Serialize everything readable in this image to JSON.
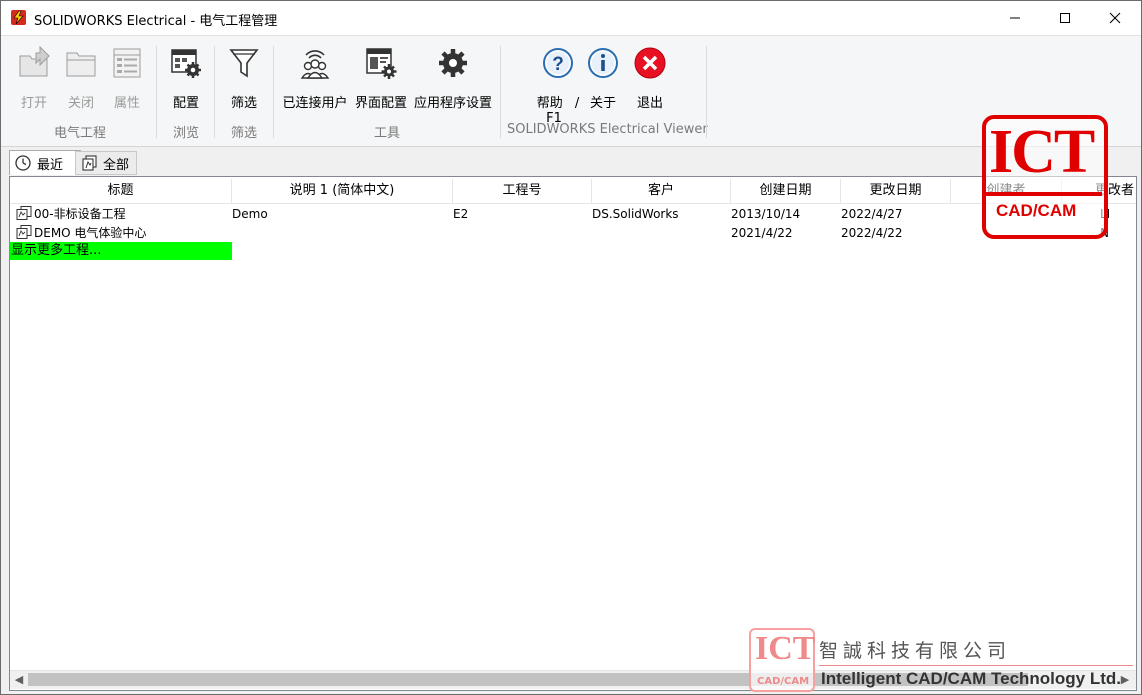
{
  "window": {
    "title": "SOLIDWORKS Electrical - 电气工程管理"
  },
  "ribbon": {
    "buttons": {
      "open": "打开",
      "close": "关闭",
      "properties": "属性",
      "configure": "配置",
      "filter": "筛选",
      "connected_users": "已连接用户",
      "interface_config": "界面配置",
      "app_settings": "应用程序设置",
      "help": "帮助",
      "help_slash": "/",
      "help_key": "F1",
      "about": "关于",
      "exit": "退出"
    },
    "groups": {
      "project": "电气工程",
      "browse": "浏览",
      "filter": "筛选",
      "tools": "工具",
      "viewer": "SOLIDWORKS Electrical Viewer"
    }
  },
  "tabs": {
    "recent": "最近",
    "all": "全部"
  },
  "table": {
    "headers": {
      "title": "标题",
      "desc": "说明 1 (简体中文)",
      "project_no": "工程号",
      "customer": "客户",
      "created": "创建日期",
      "modified": "更改日期",
      "creator": "创建者",
      "modifier": "更改者"
    },
    "rows": [
      {
        "title": "00-非标设备工程",
        "desc": "Demo",
        "project_no": "E2",
        "customer": "DS.SolidWorks",
        "created": "2013/10/14",
        "modified": "2022/4/27",
        "creator": "",
        "modifier": "LI"
      },
      {
        "title": "DEMO 电气体验中心",
        "desc": "",
        "project_no": "",
        "customer": "",
        "created": "2021/4/22",
        "modified": "2022/4/22",
        "creator": "",
        "modifier": "N"
      }
    ],
    "show_more": "显示更多工程..."
  },
  "watermark": {
    "top_logo_big": "ICT",
    "top_logo_small": "CAD/CAM",
    "bottom_logo_big": "ICT",
    "bottom_logo_small": "CAD/CAM",
    "company_cn": "智誠科技有限公司",
    "company_en": "Intelligent CAD/CAM Technology Ltd."
  },
  "colors": {
    "show_more_bg": "#00ff00",
    "watermark_red": "#e00000",
    "exit_red": "#e81123",
    "help_blue": "#2a6db0"
  }
}
